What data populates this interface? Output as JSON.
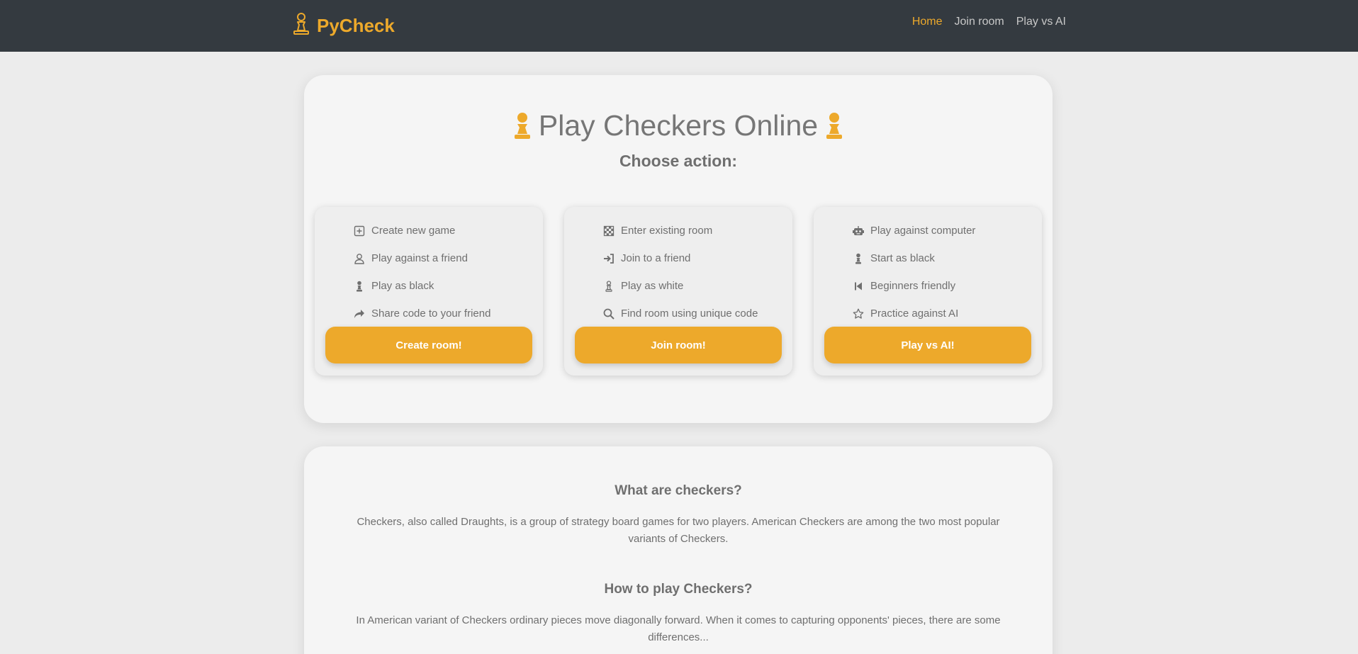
{
  "nav": {
    "brand": "PyCheck",
    "links": [
      {
        "label": "Home",
        "active": true
      },
      {
        "label": "Join room",
        "active": false
      },
      {
        "label": "Play vs AI",
        "active": false
      }
    ]
  },
  "hero": {
    "title": "Play Checkers Online",
    "subtitle": "Choose action:"
  },
  "cards": [
    {
      "items": [
        {
          "icon": "plus-square-icon",
          "label": "Create new game"
        },
        {
          "icon": "person-icon",
          "label": "Play against a friend"
        },
        {
          "icon": "pawn-filled-icon",
          "label": "Play as black"
        },
        {
          "icon": "share-arrow-icon",
          "label": "Share code to your friend"
        }
      ],
      "button": "Create room!"
    },
    {
      "items": [
        {
          "icon": "checkerboard-icon",
          "label": "Enter existing room"
        },
        {
          "icon": "sign-in-icon",
          "label": "Join to a friend"
        },
        {
          "icon": "pawn-outline-icon",
          "label": "Play as white"
        },
        {
          "icon": "search-icon",
          "label": "Find room using unique code"
        }
      ],
      "button": "Join room!"
    },
    {
      "items": [
        {
          "icon": "robot-icon",
          "label": "Play against computer"
        },
        {
          "icon": "pawn-filled-icon",
          "label": "Start as black"
        },
        {
          "icon": "skip-back-icon",
          "label": "Beginners friendly"
        },
        {
          "icon": "star-outline-icon",
          "label": "Practice against AI"
        }
      ],
      "button": "Play vs AI!"
    }
  ],
  "info": {
    "q1": "What are checkers?",
    "a1": "Checkers, also called Draughts, is a group of strategy board games for two players. American Checkers are among the two most popular variants of Checkers.",
    "q2": "How to play Checkers?",
    "a2": "In American variant of Checkers ordinary pieces move diagonally forward. When it comes to capturing opponents' pieces, there are some differences..."
  },
  "colors": {
    "accent": "#eda92b",
    "navbar": "#343a40",
    "background": "#ececec",
    "card": "#f5f5f5"
  }
}
